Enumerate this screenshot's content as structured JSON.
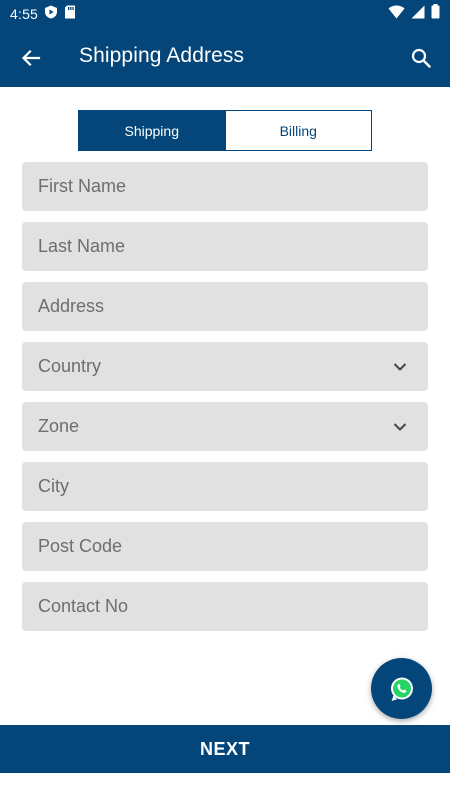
{
  "status_bar": {
    "time": "4:55"
  },
  "app_bar": {
    "title": "Shipping Address"
  },
  "tabs": [
    {
      "label": "Shipping",
      "active": true
    },
    {
      "label": "Billing",
      "active": false
    }
  ],
  "form": {
    "fields": [
      {
        "placeholder": "First Name",
        "type": "text"
      },
      {
        "placeholder": "Last Name",
        "type": "text"
      },
      {
        "placeholder": "Address",
        "type": "text"
      },
      {
        "placeholder": "Country",
        "type": "dropdown"
      },
      {
        "placeholder": "Zone",
        "type": "dropdown"
      },
      {
        "placeholder": "City",
        "type": "text"
      },
      {
        "placeholder": "Post Code",
        "type": "text"
      },
      {
        "placeholder": "Contact No",
        "type": "text"
      }
    ]
  },
  "fab": {
    "icon": "whatsapp-icon"
  },
  "footer": {
    "next_label": "NEXT"
  },
  "colors": {
    "primary": "#04467a",
    "field_bg": "#e1e1e1",
    "placeholder": "#6e6e6e"
  }
}
